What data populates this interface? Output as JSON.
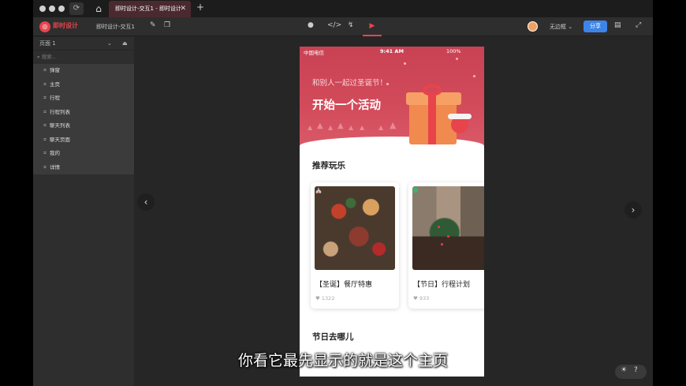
{
  "titlebar": {
    "tab_title": "即时设计-交互1 - 即时设计",
    "tab_close": "✕",
    "tab_add": "+",
    "refresh_icon": "⟳",
    "home_icon": "⌂"
  },
  "toolbar": {
    "brand": "即时设计",
    "project": "即时设计-交互1",
    "device": "无边框 ⌄",
    "share": "分享"
  },
  "sidebar": {
    "page_name": "页面 1",
    "search_placeholder": "搜索...",
    "items": [
      {
        "label": "弹窗"
      },
      {
        "label": "主页"
      },
      {
        "label": "行程"
      },
      {
        "label": "行程列表"
      },
      {
        "label": "聊天列表"
      },
      {
        "label": "聊天页面"
      },
      {
        "label": "我的"
      },
      {
        "label": "详情"
      }
    ]
  },
  "phone": {
    "status": {
      "carrier": "中国电信",
      "time": "9:41 AM",
      "battery": "100%"
    },
    "hero": {
      "subtitle": "和别人一起过圣诞节！",
      "title": "开始一个活动"
    },
    "section1": "推荐玩乐",
    "cards": [
      {
        "name": "【圣诞】餐厅特惠",
        "likes": "1322",
        "badge_color": "#e8444b"
      },
      {
        "name": "【节日】行程计划",
        "likes": "933",
        "badge_color": "#3db36b"
      }
    ],
    "section2": "节日去哪儿"
  },
  "subtitle": "你看它最先显示的就是这个主页",
  "icons": {
    "like": "♥",
    "frame": "⌗",
    "arrow_left": "‹",
    "arrow_right": "›"
  },
  "colors": {
    "accent": "#e8444b",
    "share_blue": "#3d84e8",
    "hero_red": "#c94253"
  }
}
